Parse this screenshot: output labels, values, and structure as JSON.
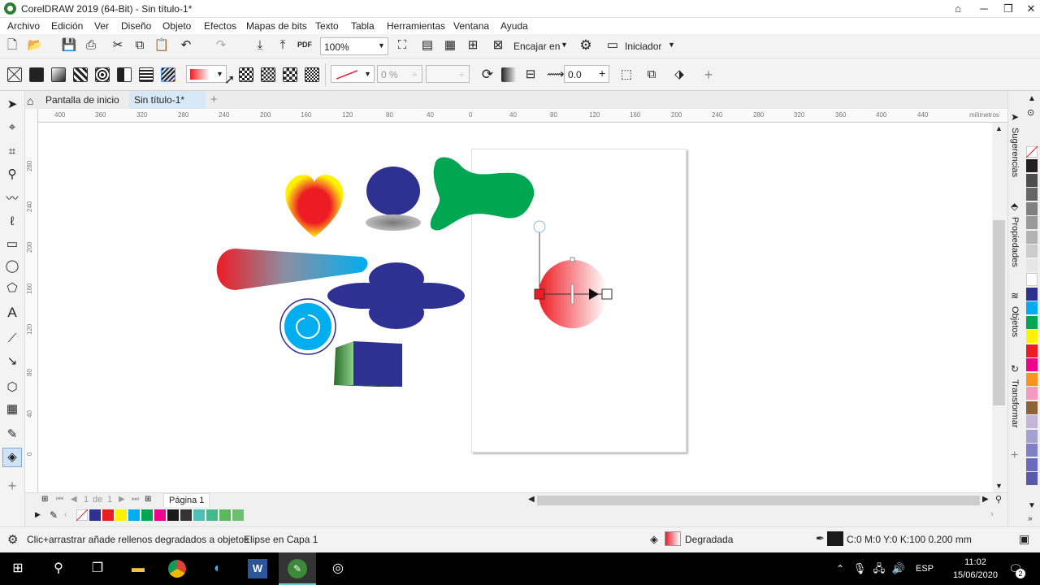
{
  "window": {
    "title": "CorelDRAW 2019 (64-Bit) - Sin título-1*"
  },
  "menu": [
    "Archivo",
    "Edición",
    "Ver",
    "Diseño",
    "Objeto",
    "Efectos",
    "Mapas de bits",
    "Texto",
    "Tabla",
    "Herramientas",
    "Ventana",
    "Ayuda"
  ],
  "toolbar": {
    "zoom_value": "100%",
    "snap_label": "Encajar en",
    "workspace_label": "Iniciador",
    "pdf_label": "PDF"
  },
  "propbar": {
    "transparency_value": "0 %",
    "angle_value": "0.0"
  },
  "tabs": {
    "home_label": "Pantalla de inicio",
    "doc_label": "Sin título-1*"
  },
  "ruler": {
    "unit": "milímetros",
    "h_ticks": [
      "400",
      "360",
      "320",
      "280",
      "240",
      "200",
      "160",
      "120",
      "80",
      "40",
      "0",
      "40",
      "80",
      "120",
      "160",
      "200",
      "240",
      "280",
      "320",
      "360",
      "400",
      "440"
    ],
    "v_ticks": [
      "280",
      "240",
      "200",
      "160",
      "120",
      "80",
      "40",
      "0"
    ]
  },
  "pagenav": {
    "current": "1",
    "of_label": "de",
    "total": "1",
    "page_label": "Página 1"
  },
  "dockers": [
    "Sugerencias",
    "Propiedades",
    "Objetos",
    "Transformar"
  ],
  "palette_bottom": [
    "#2e3192",
    "#ed1c24",
    "#fff200",
    "#00aeef",
    "#00a651",
    "#ec008c",
    "#1a1a1a",
    "#333333",
    "#4dbfb4",
    "#46b98c",
    "#5cb85c",
    "#6cc070"
  ],
  "palette_right": [
    "#231f20",
    "#4d4d4d",
    "#666666",
    "#808080",
    "#999999",
    "#b3b3b3",
    "#cccccc",
    "#e6e6e6",
    "#ffffff",
    "#2e3192",
    "#00aeef",
    "#00a651",
    "#fff200",
    "#ed1c24",
    "#ec008c",
    "#f7941d",
    "#f49ac1",
    "#8c6239",
    "#c2b5d8",
    "#a5a0d0",
    "#7f7fc8",
    "#6a6abf",
    "#5959a9"
  ],
  "status": {
    "hint": "Clic+arrastrar añade rellenos degradados a objetos",
    "object": "Elipse en Capa 1",
    "fill_label": "Degradada",
    "outline": "C:0 M:0 Y:0 K:100  0.200 mm"
  },
  "taskbar": {
    "lang": "ESP",
    "time": "11:02",
    "date": "15/06/2020",
    "notif_count": "2"
  }
}
